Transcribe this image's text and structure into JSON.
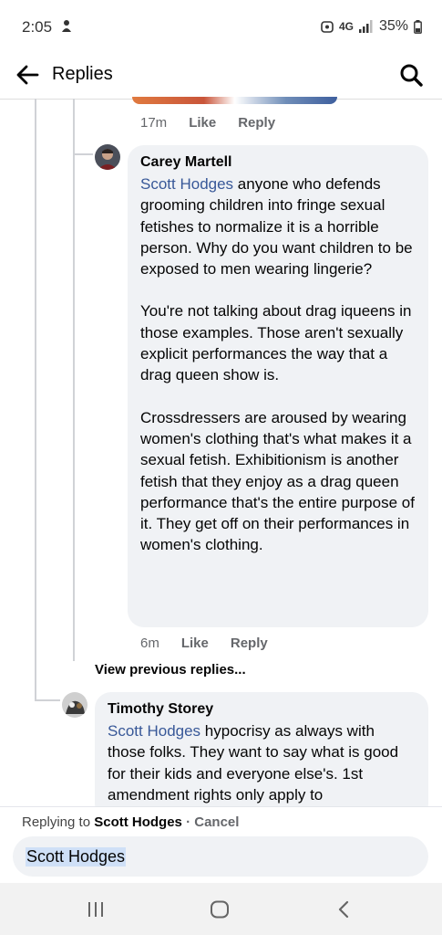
{
  "status": {
    "time": "2:05",
    "network": "4G",
    "battery": "35%"
  },
  "header": {
    "title": "Replies",
    "back_icon": "arrow-left-icon",
    "search_icon": "search-icon"
  },
  "top_comment_actions": {
    "time": "17m",
    "like": "Like",
    "reply": "Reply"
  },
  "comments": [
    {
      "author": "Carey Martell",
      "mention": "Scott Hodges",
      "paragraphs": [
        " anyone who defends grooming children into fringe sexual fetishes to normalize it is a horrible person. Why do you want children to be exposed to men wearing lingerie?",
        "You're not talking about drag iqueens in those examples. Those aren't sexually explicit performances the way that a drag queen show is.",
        "Crossdressers are aroused by wearing women's clothing that's what makes it a sexual fetish. Exhibitionism is another fetish that they enjoy as a drag queen performance that's the entire purpose of it. They get off on their performances in women's clothing."
      ],
      "time": "6m",
      "like": "Like",
      "reply": "Reply"
    },
    {
      "author": "Timothy Storey",
      "mention": "Scott Hodges",
      "text": " hypocrisy as always with those folks.  They want to say what is good for their kids and everyone else's. 1st amendment rights only apply to"
    }
  ],
  "view_previous": "View previous replies...",
  "reply_bar": {
    "replying_prefix": "Replying to",
    "replying_name": "Scott Hodges",
    "separator": "·",
    "cancel": "Cancel",
    "input_value": "Scott Hodges"
  },
  "nav": {
    "recents_icon": "recents-icon",
    "home_icon": "home-icon",
    "back_icon": "back-chevron-icon"
  },
  "colors": {
    "mention": "#385898",
    "bubble": "#f0f2f5",
    "meta": "#65676b"
  }
}
